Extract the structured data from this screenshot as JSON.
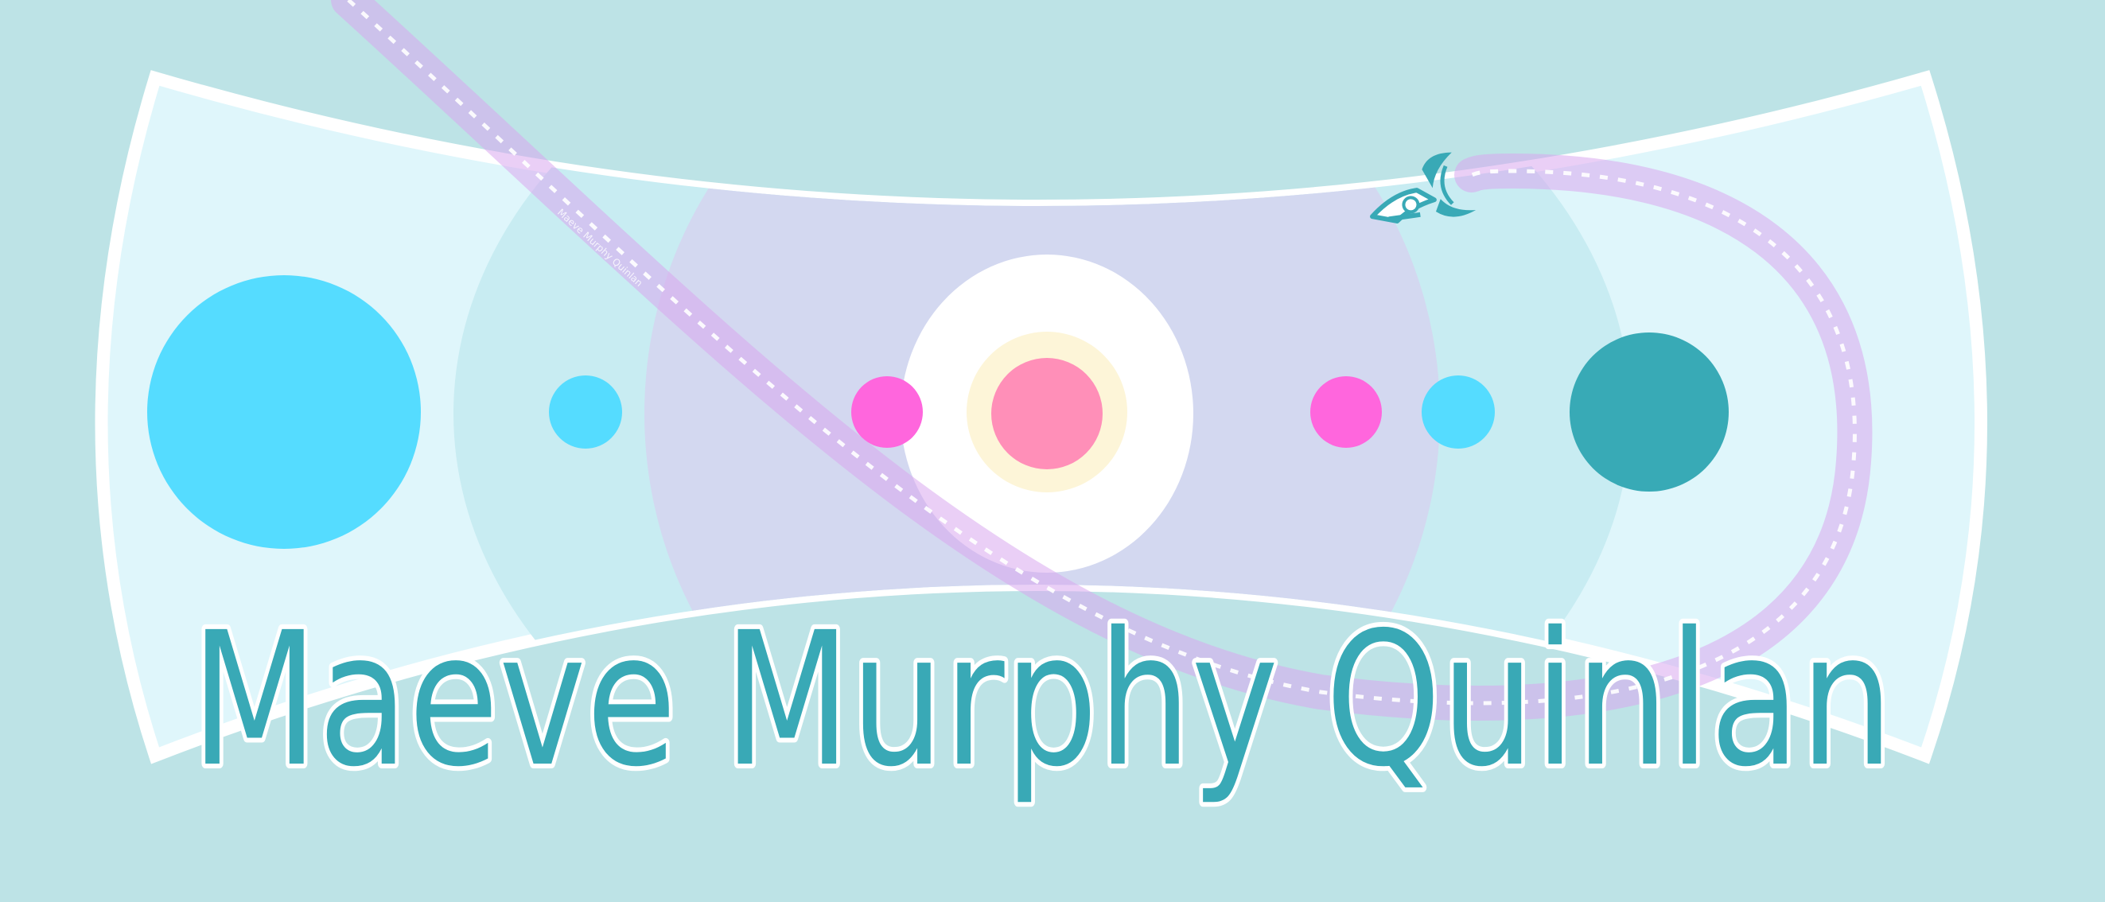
{
  "banner": {
    "name": "Maeve Murphy Quinlan",
    "trail_caption": "Maeve Murphy Quinlan"
  },
  "colors": {
    "background": "#bde3e6",
    "outer_band": "#dff6fb",
    "middle_band": "#c8ecf2",
    "inner_band": "#d3d8f0",
    "center_white": "#ffffff",
    "center_ring": "#fdf5d8",
    "center_dot": "#ff8fb8",
    "magenta_dot": "#ff66dd",
    "cyan_dot": "#55dcff",
    "teal_dot": "#38aab6",
    "trail": "#d8a8ee",
    "text_fill": "#39a9b6",
    "text_outline": "#ffffff"
  },
  "icons": [
    "rocket-icon"
  ]
}
